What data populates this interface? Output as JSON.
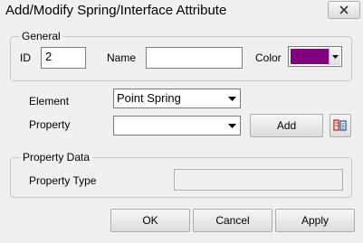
{
  "window": {
    "title": "Add/Modify Spring/Interface Attribute",
    "close_icon": "close-icon"
  },
  "general": {
    "legend": "General",
    "id_label": "ID",
    "id_value": "2",
    "name_label": "Name",
    "name_value": "",
    "color_label": "Color",
    "color_value": "#800080"
  },
  "element": {
    "label": "Element",
    "selected": "Point Spring"
  },
  "property": {
    "label": "Property",
    "selected": "",
    "add_label": "Add",
    "manager_icon": "property-manager-icon"
  },
  "property_data": {
    "legend": "Property Data",
    "type_label": "Property Type",
    "type_value": ""
  },
  "buttons": {
    "ok": "OK",
    "cancel": "Cancel",
    "apply": "Apply"
  }
}
